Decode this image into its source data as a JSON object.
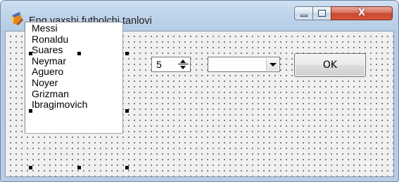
{
  "window": {
    "title": "Eng yaxshi futbolchi tanlovi",
    "icon": "delphi-app-icon",
    "controls": {
      "minimize_icon": "minimize-icon",
      "maximize_icon": "maximize-icon",
      "close_glyph": "X"
    }
  },
  "listbox": {
    "items": [
      "Messi",
      "Ronaldu",
      "Suares",
      "Neymar",
      "Aguero",
      "Noyer",
      "Grizman",
      "Ibragimovich"
    ]
  },
  "spinedit": {
    "value": "5"
  },
  "combobox": {
    "value": ""
  },
  "ok_button": {
    "label": "OK"
  },
  "colors": {
    "titlebar": "#c4d7ed",
    "form_background": "#f0f0f0",
    "close_button": "#c84a2f"
  }
}
